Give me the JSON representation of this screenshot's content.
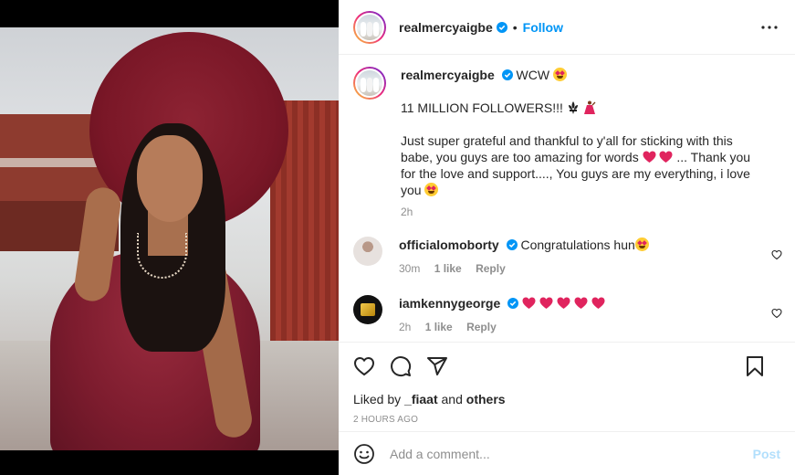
{
  "post": {
    "username": "realmercyaigbe",
    "follow_label": "Follow",
    "separator": "•"
  },
  "caption": {
    "username": "realmercyaigbe",
    "headline_text": "WCW",
    "line1_text": "11 MILLION FOLLOWERS!!!",
    "para_a": "Just super grateful and thankful to y'all for sticking with this babe, you guys are too amazing for words",
    "para_b": "... Thank you for the love and support...., You guys are my everything, i love you",
    "time": "2h"
  },
  "comments": [
    {
      "username": "officialomoborty",
      "text": "Congratulations hun",
      "time": "30m",
      "likes": "1 like",
      "reply": "Reply"
    },
    {
      "username": "iamkennygeorge",
      "text": "",
      "time": "2h",
      "likes": "1 like",
      "reply": "Reply"
    }
  ],
  "actions": {
    "liked_prefix": "Liked by",
    "liked_user": "_fiaat",
    "liked_and": "and",
    "liked_others": "others",
    "timestamp": "2 HOURS AGO"
  },
  "comment_box": {
    "placeholder": "Add a comment...",
    "post_label": "Post"
  },
  "icons": [
    "verified-icon",
    "more-icon",
    "star-struck-emoji",
    "fleur-de-lis-emoji",
    "dancer-emoji",
    "red-heart-emoji",
    "heart-icon",
    "comment-icon",
    "share-icon",
    "bookmark-icon",
    "emoji-icon"
  ],
  "colors": {
    "accent": "#0095f6",
    "post_disabled": "#b2dffc",
    "heart_red": "#e0245e",
    "text_muted": "#8e8e8e"
  }
}
